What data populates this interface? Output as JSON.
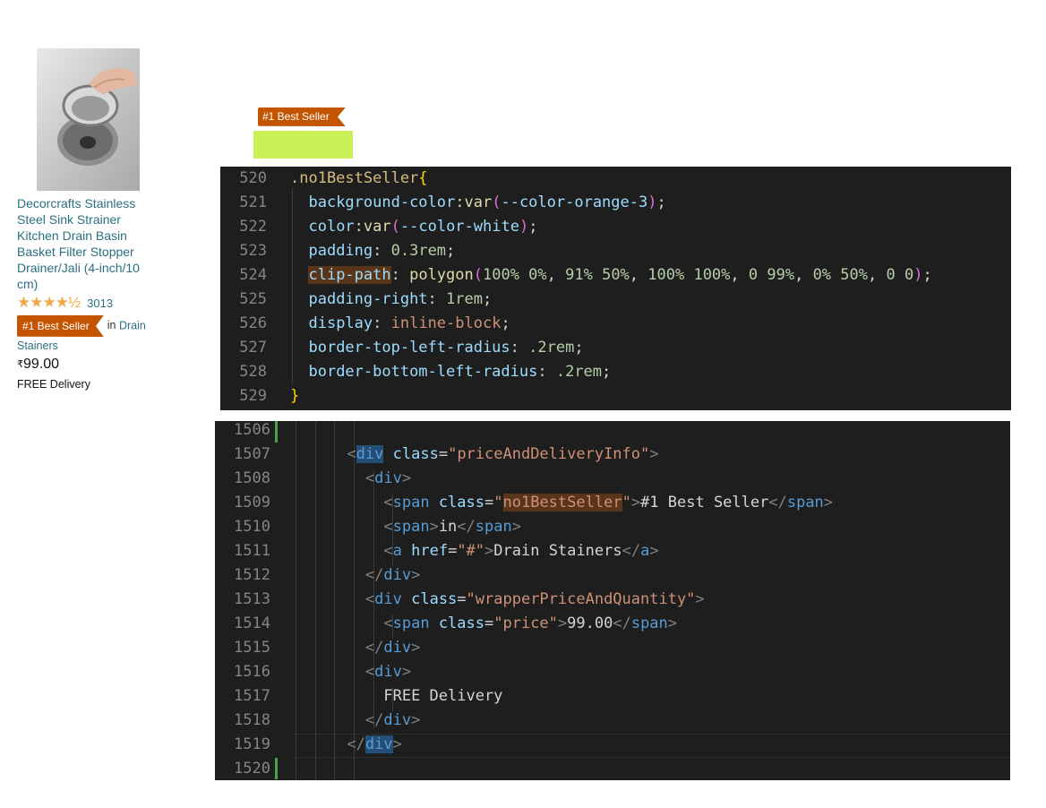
{
  "product": {
    "title": "Decorcrafts Stainless Steel Sink Strainer Kitchen Drain Basin Basket Filter Stopper Drainer/Jali (4-inch/10 cm)",
    "rating_stars": "★★★★½",
    "rating_value": 4.5,
    "rating_count": "3013",
    "badge": "#1 Best Seller",
    "in_text": "in",
    "category": "Drain Stainers",
    "currency": "₹",
    "price": "99.00",
    "delivery": "FREE Delivery"
  },
  "preview": {
    "badge": "#1 Best Seller",
    "highlight_color": "#c9f055"
  },
  "colors": {
    "badge_bg": "#c45500",
    "link": "#2b6f80",
    "editor_bg": "#1e1e1e",
    "modified_gutter": "#4aa04a"
  },
  "css_editor": {
    "lines": [
      {
        "n": "520",
        "parts": [
          {
            "c": "sel",
            "t": ".no1BestSeller"
          },
          {
            "c": "brk",
            "t": "{"
          }
        ]
      },
      {
        "n": "521",
        "parts": [
          {
            "c": "pun",
            "t": "  "
          },
          {
            "c": "prp",
            "t": "background-color"
          },
          {
            "c": "pun",
            "t": ":"
          },
          {
            "c": "fn",
            "t": "var"
          },
          {
            "c": "brk2",
            "t": "("
          },
          {
            "c": "prp",
            "t": "--color-orange-3"
          },
          {
            "c": "brk2",
            "t": ")"
          },
          {
            "c": "pun",
            "t": ";"
          }
        ]
      },
      {
        "n": "522",
        "parts": [
          {
            "c": "pun",
            "t": "  "
          },
          {
            "c": "prp",
            "t": "color"
          },
          {
            "c": "pun",
            "t": ":"
          },
          {
            "c": "fn",
            "t": "var"
          },
          {
            "c": "brk2",
            "t": "("
          },
          {
            "c": "prp",
            "t": "--color-white"
          },
          {
            "c": "brk2",
            "t": ")"
          },
          {
            "c": "pun",
            "t": ";"
          }
        ]
      },
      {
        "n": "523",
        "parts": [
          {
            "c": "pun",
            "t": "  "
          },
          {
            "c": "prp",
            "t": "padding"
          },
          {
            "c": "pun",
            "t": ": "
          },
          {
            "c": "num",
            "t": "0.3rem"
          },
          {
            "c": "pun",
            "t": ";"
          }
        ]
      },
      {
        "n": "524",
        "parts": [
          {
            "c": "pun",
            "t": "  "
          },
          {
            "c": "prp mark",
            "t": "clip-path"
          },
          {
            "c": "pun",
            "t": ": "
          },
          {
            "c": "fn",
            "t": "polygon"
          },
          {
            "c": "brk2",
            "t": "("
          },
          {
            "c": "num",
            "t": "100% 0%"
          },
          {
            "c": "pun",
            "t": ", "
          },
          {
            "c": "num",
            "t": "91% 50%"
          },
          {
            "c": "pun",
            "t": ", "
          },
          {
            "c": "num",
            "t": "100% 100%"
          },
          {
            "c": "pun",
            "t": ", "
          },
          {
            "c": "num",
            "t": "0 99%"
          },
          {
            "c": "pun",
            "t": ", "
          },
          {
            "c": "num",
            "t": "0% 50%"
          },
          {
            "c": "pun",
            "t": ", "
          },
          {
            "c": "num",
            "t": "0 0"
          },
          {
            "c": "brk2",
            "t": ")"
          },
          {
            "c": "pun",
            "t": ";"
          }
        ]
      },
      {
        "n": "525",
        "parts": [
          {
            "c": "pun",
            "t": "  "
          },
          {
            "c": "prp",
            "t": "padding-right"
          },
          {
            "c": "pun",
            "t": ": "
          },
          {
            "c": "num",
            "t": "1rem"
          },
          {
            "c": "pun",
            "t": ";"
          }
        ]
      },
      {
        "n": "526",
        "parts": [
          {
            "c": "pun",
            "t": "  "
          },
          {
            "c": "prp",
            "t": "display"
          },
          {
            "c": "pun",
            "t": ": "
          },
          {
            "c": "val",
            "t": "inline-block"
          },
          {
            "c": "pun",
            "t": ";"
          }
        ]
      },
      {
        "n": "527",
        "parts": [
          {
            "c": "pun",
            "t": "  "
          },
          {
            "c": "prp",
            "t": "border-top-left-radius"
          },
          {
            "c": "pun",
            "t": ": "
          },
          {
            "c": "num",
            "t": ".2rem"
          },
          {
            "c": "pun",
            "t": ";"
          }
        ]
      },
      {
        "n": "528",
        "parts": [
          {
            "c": "pun",
            "t": "  "
          },
          {
            "c": "prp",
            "t": "border-bottom-left-radius"
          },
          {
            "c": "pun",
            "t": ": "
          },
          {
            "c": "num",
            "t": ".2rem"
          },
          {
            "c": "pun",
            "t": ";"
          }
        ]
      },
      {
        "n": "529",
        "parts": [
          {
            "c": "brk",
            "t": "}"
          }
        ]
      }
    ]
  },
  "html_editor": {
    "current_line": "1519",
    "lines": [
      {
        "n": "1506",
        "parts": []
      },
      {
        "n": "1507",
        "parts": [
          {
            "c": "pun",
            "t": "      "
          },
          {
            "c": "ang",
            "t": "<"
          },
          {
            "c": "tag mark2",
            "t": "div"
          },
          {
            "c": "pun",
            "t": " "
          },
          {
            "c": "att",
            "t": "class"
          },
          {
            "c": "pun",
            "t": "="
          },
          {
            "c": "str",
            "t": "\"priceAndDeliveryInfo\""
          },
          {
            "c": "ang",
            "t": ">"
          }
        ]
      },
      {
        "n": "1508",
        "parts": [
          {
            "c": "pun",
            "t": "        "
          },
          {
            "c": "ang",
            "t": "<"
          },
          {
            "c": "tag",
            "t": "div"
          },
          {
            "c": "ang",
            "t": ">"
          }
        ]
      },
      {
        "n": "1509",
        "parts": [
          {
            "c": "pun",
            "t": "          "
          },
          {
            "c": "ang",
            "t": "<"
          },
          {
            "c": "tag",
            "t": "span"
          },
          {
            "c": "pun",
            "t": " "
          },
          {
            "c": "att",
            "t": "class"
          },
          {
            "c": "pun",
            "t": "="
          },
          {
            "c": "str",
            "t": "\""
          },
          {
            "c": "str mark",
            "t": "no1BestSeller"
          },
          {
            "c": "str",
            "t": "\""
          },
          {
            "c": "ang",
            "t": ">"
          },
          {
            "c": "txt",
            "t": "#1 Best Seller"
          },
          {
            "c": "ang",
            "t": "</"
          },
          {
            "c": "tag",
            "t": "span"
          },
          {
            "c": "ang",
            "t": ">"
          }
        ]
      },
      {
        "n": "1510",
        "parts": [
          {
            "c": "pun",
            "t": "          "
          },
          {
            "c": "ang",
            "t": "<"
          },
          {
            "c": "tag",
            "t": "span"
          },
          {
            "c": "ang",
            "t": ">"
          },
          {
            "c": "txt",
            "t": "in"
          },
          {
            "c": "ang",
            "t": "</"
          },
          {
            "c": "tag",
            "t": "span"
          },
          {
            "c": "ang",
            "t": ">"
          }
        ]
      },
      {
        "n": "1511",
        "parts": [
          {
            "c": "pun",
            "t": "          "
          },
          {
            "c": "ang",
            "t": "<"
          },
          {
            "c": "tag",
            "t": "a"
          },
          {
            "c": "pun",
            "t": " "
          },
          {
            "c": "att",
            "t": "href"
          },
          {
            "c": "pun",
            "t": "="
          },
          {
            "c": "str",
            "t": "\"#\""
          },
          {
            "c": "ang",
            "t": ">"
          },
          {
            "c": "txt",
            "t": "Drain Stainers"
          },
          {
            "c": "ang",
            "t": "</"
          },
          {
            "c": "tag",
            "t": "a"
          },
          {
            "c": "ang",
            "t": ">"
          }
        ]
      },
      {
        "n": "1512",
        "parts": [
          {
            "c": "pun",
            "t": "        "
          },
          {
            "c": "ang",
            "t": "</"
          },
          {
            "c": "tag",
            "t": "div"
          },
          {
            "c": "ang",
            "t": ">"
          }
        ]
      },
      {
        "n": "1513",
        "parts": [
          {
            "c": "pun",
            "t": "        "
          },
          {
            "c": "ang",
            "t": "<"
          },
          {
            "c": "tag",
            "t": "div"
          },
          {
            "c": "pun",
            "t": " "
          },
          {
            "c": "att",
            "t": "class"
          },
          {
            "c": "pun",
            "t": "="
          },
          {
            "c": "str",
            "t": "\"wrapperPriceAndQuantity\""
          },
          {
            "c": "ang",
            "t": ">"
          }
        ]
      },
      {
        "n": "1514",
        "parts": [
          {
            "c": "pun",
            "t": "          "
          },
          {
            "c": "ang",
            "t": "<"
          },
          {
            "c": "tag",
            "t": "span"
          },
          {
            "c": "pun",
            "t": " "
          },
          {
            "c": "att",
            "t": "class"
          },
          {
            "c": "pun",
            "t": "="
          },
          {
            "c": "str",
            "t": "\"price\""
          },
          {
            "c": "ang",
            "t": ">"
          },
          {
            "c": "txt",
            "t": "99.00"
          },
          {
            "c": "ang",
            "t": "</"
          },
          {
            "c": "tag",
            "t": "span"
          },
          {
            "c": "ang",
            "t": ">"
          }
        ]
      },
      {
        "n": "1515",
        "parts": [
          {
            "c": "pun",
            "t": "        "
          },
          {
            "c": "ang",
            "t": "</"
          },
          {
            "c": "tag",
            "t": "div"
          },
          {
            "c": "ang",
            "t": ">"
          }
        ]
      },
      {
        "n": "1516",
        "parts": [
          {
            "c": "pun",
            "t": "        "
          },
          {
            "c": "ang",
            "t": "<"
          },
          {
            "c": "tag",
            "t": "div"
          },
          {
            "c": "ang",
            "t": ">"
          }
        ]
      },
      {
        "n": "1517",
        "parts": [
          {
            "c": "pun",
            "t": "          "
          },
          {
            "c": "txt",
            "t": "FREE Delivery"
          }
        ]
      },
      {
        "n": "1518",
        "parts": [
          {
            "c": "pun",
            "t": "        "
          },
          {
            "c": "ang",
            "t": "</"
          },
          {
            "c": "tag",
            "t": "div"
          },
          {
            "c": "ang",
            "t": ">"
          }
        ]
      },
      {
        "n": "1519",
        "parts": [
          {
            "c": "pun",
            "t": "      "
          },
          {
            "c": "ang",
            "t": "</"
          },
          {
            "c": "tag mark2",
            "t": "div"
          },
          {
            "c": "ang",
            "t": ">"
          }
        ]
      },
      {
        "n": "1520",
        "parts": []
      }
    ]
  }
}
